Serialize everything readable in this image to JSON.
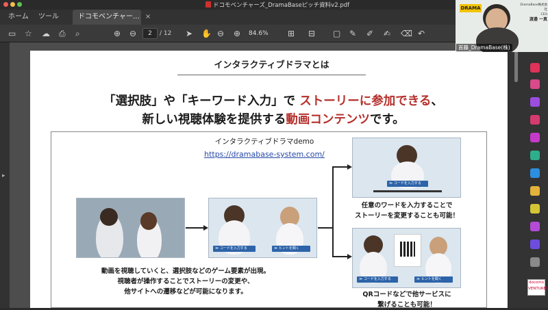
{
  "window": {
    "title": "ドコモベンチャーズ_DramaBaseピッチ資料v2.pdf"
  },
  "tabs": [
    {
      "label": "ホーム"
    },
    {
      "label": "ツール"
    },
    {
      "label": "ドコモベンチャー…",
      "close": "×"
    }
  ],
  "toolbar": {
    "page_current": "2",
    "page_total": "/ 12",
    "zoom": "84.6%"
  },
  "slide": {
    "header": "インタラクティブドラマとは",
    "headline1_a": "「選択肢」や「キーワード入力」で ",
    "headline1_b": "ストーリーに参加できる",
    "headline1_c": "、",
    "headline2_a": "新しい視聴体験を提供する",
    "headline2_b": "動画コンテンツ",
    "headline2_c": "です。",
    "demo_title": "インタラクティブドラマdemo",
    "demo_url": "https://dramabase-system.com/",
    "pill_code": "≫ コードを入力する",
    "pill_hint": "≫ ヒントを聞く",
    "left_caption": [
      "動画を視聴していくと、選択肢などのゲーム要素が出現。",
      "視聴者が操作することでストーリーの変更や、",
      "他サイトへの遷移などが可能になります。"
    ],
    "top_caption": [
      "任意のワードを入力することで",
      "ストーリーを変更することも可能！"
    ],
    "bottom_caption": [
      "QRコードなどで他サービスに",
      "繋げることも可能！"
    ]
  },
  "video": {
    "participant": "首藤_DramaBase(株)",
    "badge_company": "DramaBase株式会社",
    "badge_role": "CEO",
    "badge_name": "渡邉 一真",
    "logo": "DRAMA"
  },
  "corner_logo": "docomo VENTURES",
  "accent": "#b5302c",
  "link_color": "#2447a6"
}
